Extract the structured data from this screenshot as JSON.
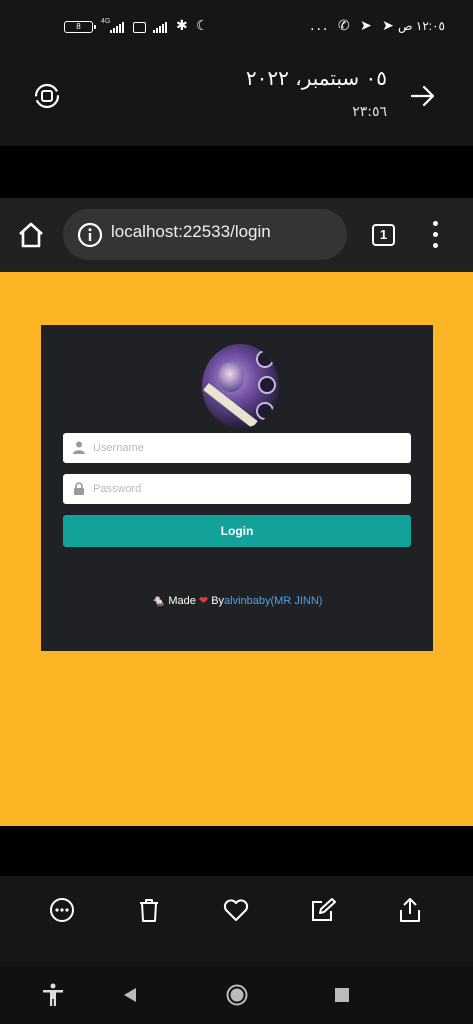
{
  "status_bar": {
    "battery": "8",
    "network_label": "4G",
    "time": "١٢:٠٥ ص",
    "overflow": "..."
  },
  "gallery": {
    "date": "٠٥ سبتمبر، ٢٠٢٢",
    "time": "٢٣:٥٦"
  },
  "browser": {
    "url": "localhost:22533/login",
    "tab_count": "1"
  },
  "login": {
    "username_placeholder": "Username",
    "password_placeholder": "Password",
    "button_label": "Login",
    "credit_made": "Made",
    "credit_by": "By",
    "credit_author": "alvinbaby(MR JINN)"
  },
  "colors": {
    "page_bg": "#fbb525",
    "card_bg": "#202124",
    "button": "#12a29a",
    "link": "#4ea1e8"
  },
  "icons": [
    "rotate-icon",
    "arrow-right-icon",
    "home-icon",
    "info-icon",
    "more-vertical-icon",
    "more-horizontal-icon",
    "trash-icon",
    "heart-icon",
    "edit-icon",
    "share-icon",
    "accessibility-icon",
    "back-icon",
    "home-circle-icon",
    "recents-icon"
  ]
}
